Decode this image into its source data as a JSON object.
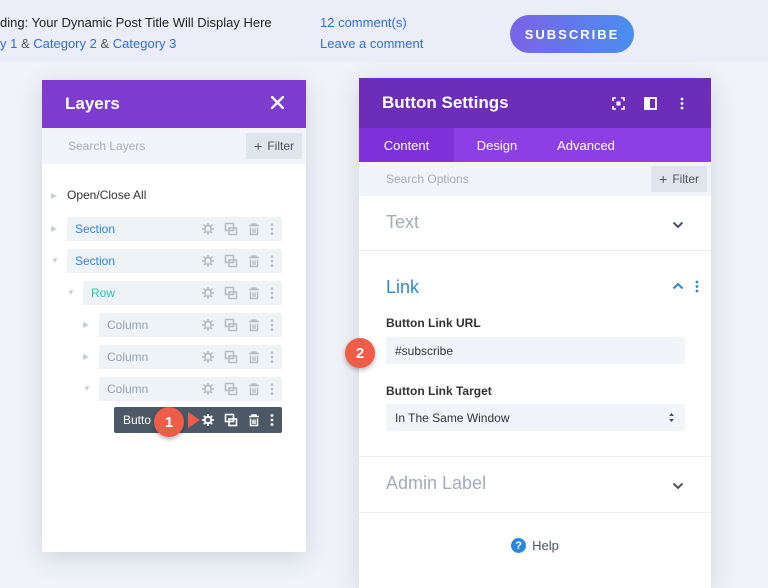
{
  "page": {
    "post_title": "ding: Your Dynamic Post Title Will Display Here",
    "cats_prefix": "y 1",
    "cats_amp1": "&",
    "cat2": "Category 2",
    "cats_amp2": "&",
    "cat3": "Category 3",
    "comment_count": "12 comment(s)",
    "leave_comment": "Leave a comment",
    "subscribe_label": "SUBSCRIBE"
  },
  "layers": {
    "title": "Layers",
    "close_icon": "close-icon",
    "search_placeholder": "Search Layers",
    "filter_label": "Filter",
    "open_close_all": "Open/Close All",
    "items": [
      {
        "label": "Section",
        "type": "section"
      },
      {
        "label": "Section",
        "type": "section"
      },
      {
        "label": "Row",
        "type": "row"
      },
      {
        "label": "Column",
        "type": "column"
      },
      {
        "label": "Column",
        "type": "column"
      },
      {
        "label": "Column",
        "type": "column"
      },
      {
        "label": "Butto",
        "type": "button"
      }
    ]
  },
  "settings": {
    "title": "Button Settings",
    "tabs": [
      "Content",
      "Design",
      "Advanced"
    ],
    "active_tab": "Content",
    "search_placeholder": "Search Options",
    "filter_label": "Filter",
    "toggles": {
      "text": "Text",
      "link": "Link",
      "admin_label": "Admin Label"
    },
    "link": {
      "url_label": "Button Link URL",
      "url_value": "#subscribe",
      "target_label": "Button Link Target",
      "target_value": "In The Same Window"
    },
    "help": "Help"
  },
  "badges": {
    "one": "1",
    "two": "2"
  },
  "colors": {
    "layers_header": "#7e3bd0",
    "settings_header": "#6c2eb9",
    "tabs_bg": "#8d3fe6",
    "badge": "#ef5d48",
    "section": "#2b87da",
    "row": "#29c4a9",
    "subscribe_gradient_start": "#7a63e6",
    "subscribe_gradient_end": "#4a8ff0"
  }
}
